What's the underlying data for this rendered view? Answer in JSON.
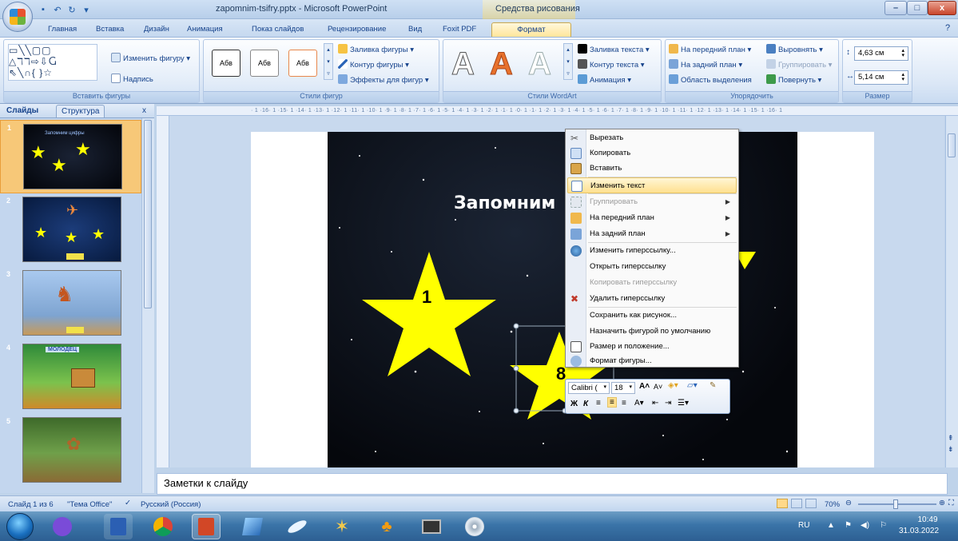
{
  "window": {
    "title": "zapomnim-tsifry.pptx - Microsoft PowerPoint",
    "tools_context": "Средства рисования"
  },
  "tabs": [
    "Главная",
    "Вставка",
    "Дизайн",
    "Анимация",
    "Показ слайдов",
    "Рецензирование",
    "Вид",
    "Foxit PDF",
    "Формат"
  ],
  "ribbon": {
    "insert_shapes": {
      "edit_shape": "Изменить фигуру",
      "textbox": "Надпись",
      "label": "Вставить фигуры"
    },
    "shape_styles": {
      "style_sample": "Абв",
      "fill": "Заливка фигуры",
      "outline": "Контур фигуры",
      "effects": "Эффекты для фигур",
      "label": "Стили фигур"
    },
    "wordart": {
      "letter": "A",
      "text_fill": "Заливка текста",
      "text_outline": "Контур текста",
      "animation": "Анимация",
      "label": "Стили WordArt"
    },
    "arrange": {
      "bring_front": "На передний план",
      "send_back": "На задний план",
      "selection_pane": "Область выделения",
      "align": "Выровнять",
      "group": "Группировать",
      "rotate": "Повернуть",
      "label": "Упорядочить"
    },
    "size": {
      "height": "4,63 см",
      "width": "5,14 см",
      "label": "Размер"
    }
  },
  "pane": {
    "tab_slides": "Слайды",
    "tab_outline": "Структура",
    "close": "x"
  },
  "thumbnails": [
    {
      "num": "1",
      "title": "Запомним цифры"
    },
    {
      "num": "2"
    },
    {
      "num": "3"
    },
    {
      "num": "4",
      "title": "МОЛОДЕЦ"
    },
    {
      "num": "5"
    }
  ],
  "ruler": "· 1 ·16· 1 ·15· 1 ·14· 1 ·13· 1 ·12· 1 ·11· 1 ·10· 1 ·9· 1 ·8· 1 ·7· 1 ·6· 1 ·5· 1 ·4· 1 ·3· 1 ·2· 1 ·1· 1 ·0· 1 ·1· 1 ·2· 1 ·3· 1 ·4· 1 ·5· 1 ·6· 1 ·7· 1 ·8· 1 ·9· 1 ·10· 1 ·11· 1 ·12· 1 ·13· 1 ·14· 1 ·15· 1 ·16· 1",
  "slide": {
    "title": "Запомним",
    "star1": "1",
    "star2": "8"
  },
  "context_menu": [
    {
      "label": "Вырезать",
      "icon": "scissors-icon",
      "state": "normal"
    },
    {
      "label": "Копировать",
      "icon": "copy-icon",
      "state": "normal"
    },
    {
      "label": "Вставить",
      "icon": "paste-icon",
      "state": "normal"
    },
    {
      "label": "Изменить текст",
      "icon": "edit-text-icon",
      "state": "highlighted"
    },
    {
      "label": "Группировать",
      "icon": "group-icon",
      "state": "disabled",
      "submenu": true
    },
    {
      "label": "На передний план",
      "icon": "bring-front-icon",
      "state": "normal",
      "submenu": true
    },
    {
      "label": "На задний план",
      "icon": "send-back-icon",
      "state": "normal",
      "submenu": true
    },
    {
      "label": "Изменить гиперссылку...",
      "icon": "hyperlink-icon",
      "state": "normal"
    },
    {
      "label": "Открыть гиперссылку",
      "state": "normal"
    },
    {
      "label": "Копировать гиперссылку",
      "state": "disabled"
    },
    {
      "label": "Удалить гиперссылку",
      "icon": "remove-link-icon",
      "state": "normal"
    },
    {
      "label": "Сохранить как рисунок...",
      "state": "normal"
    },
    {
      "label": "Назначить фигурой по умолчанию",
      "state": "normal"
    },
    {
      "label": "Размер и положение...",
      "icon": "size-position-icon",
      "state": "normal"
    },
    {
      "label": "Формат фигуры...",
      "icon": "format-shape-icon",
      "state": "normal"
    }
  ],
  "mini_toolbar": {
    "font": "Calibri (",
    "size": "18"
  },
  "notes": "Заметки к слайду",
  "status": {
    "slide": "Слайд 1 из 6",
    "theme": "\"Тема Office\"",
    "language": "Русский (Россия)",
    "zoom": "70%"
  },
  "tray": {
    "lang": "RU",
    "time": "10:49",
    "date": "31.03.2022"
  },
  "colors": {
    "accent": "#ffe08f",
    "ribbon": "#dbe7f6",
    "star": "#ffff00"
  }
}
